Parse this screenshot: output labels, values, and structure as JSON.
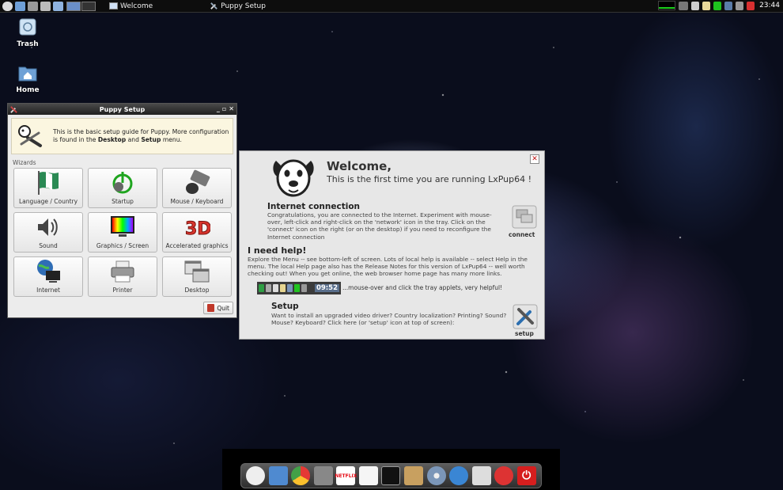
{
  "top_panel": {
    "tasks": [
      {
        "label": "Welcome"
      },
      {
        "label": "Puppy Setup"
      }
    ],
    "clock": "23:44"
  },
  "desktop": {
    "icons": [
      {
        "label": "Trash",
        "icon": "trash-icon"
      },
      {
        "label": "Home",
        "icon": "home-folder-icon"
      }
    ]
  },
  "setup_window": {
    "title": "Puppy Setup",
    "intro_pre": "This is the basic setup guide for Puppy. More configuration is found in the ",
    "intro_bold1": "Desktop",
    "intro_mid": " and ",
    "intro_bold2": "Setup",
    "intro_post": " menu.",
    "wizards_label": "Wizards",
    "buttons": [
      {
        "label": "Language / Country",
        "icon": "flag-icon"
      },
      {
        "label": "Startup",
        "icon": "startup-power-icon"
      },
      {
        "label": "Mouse / Keyboard",
        "icon": "mouse-keyboard-icon"
      },
      {
        "label": "Sound",
        "icon": "speaker-icon"
      },
      {
        "label": "Graphics / Screen",
        "icon": "monitor-rainbow-icon"
      },
      {
        "label": "Accelerated graphics",
        "icon": "3d-icon"
      },
      {
        "label": "Internet",
        "icon": "globe-computer-icon"
      },
      {
        "label": "Printer",
        "icon": "printer-icon"
      },
      {
        "label": "Desktop",
        "icon": "windows-desktop-icon"
      }
    ],
    "quit_label": "Quit"
  },
  "welcome_window": {
    "title": "Welcome,",
    "subtitle": "This is the first time you are running LxPup64 !",
    "internet_heading": "Internet connection",
    "internet_text": "Congratulations, you are connected to the Internet. Experiment with mouse-over, left-click and right-click on the 'network' icon in the tray. Click on the 'connect' icon on the right (or on the desktop) if you need to reconfigure the Internet connection",
    "connect_label": "connect",
    "help_heading": "I need help!",
    "help_text": "Explore the Menu -- see bottom-left of screen. Lots of local help is available -- select Help in the menu. The local Help page also has the Release Notes for this version of LxPup64 -- well worth checking out! When you get online, the web browser home page has many more links.",
    "tray_clock": "09:52",
    "tray_caption": "...mouse-over and click the tray applets, very helpful!",
    "setup_heading": "Setup",
    "setup_text": "Want to install an upgraded video driver? Country localization? Printing? Sound? Mouse? Keyboard? Click here (or 'setup' icon at top of screen):",
    "setup_label": "setup"
  },
  "dock": {
    "items": [
      {
        "icon": "puppy-menu-icon",
        "text": ""
      },
      {
        "icon": "file-manager-icon",
        "text": ""
      },
      {
        "icon": "chrome-browser-icon",
        "text": ""
      },
      {
        "icon": "lock-icon",
        "text": ""
      },
      {
        "icon": "netflix-icon",
        "text": "NETFLIX"
      },
      {
        "icon": "document-icon",
        "text": ""
      },
      {
        "icon": "terminal-icon",
        "text": ""
      },
      {
        "icon": "package-box-icon",
        "text": ""
      },
      {
        "icon": "disc-icon",
        "text": ""
      },
      {
        "icon": "settings-gears-icon",
        "text": ""
      },
      {
        "icon": "puppy-setup-icon",
        "text": ""
      },
      {
        "icon": "network-wizard-icon",
        "text": ""
      },
      {
        "icon": "power-icon",
        "text": ""
      }
    ]
  }
}
